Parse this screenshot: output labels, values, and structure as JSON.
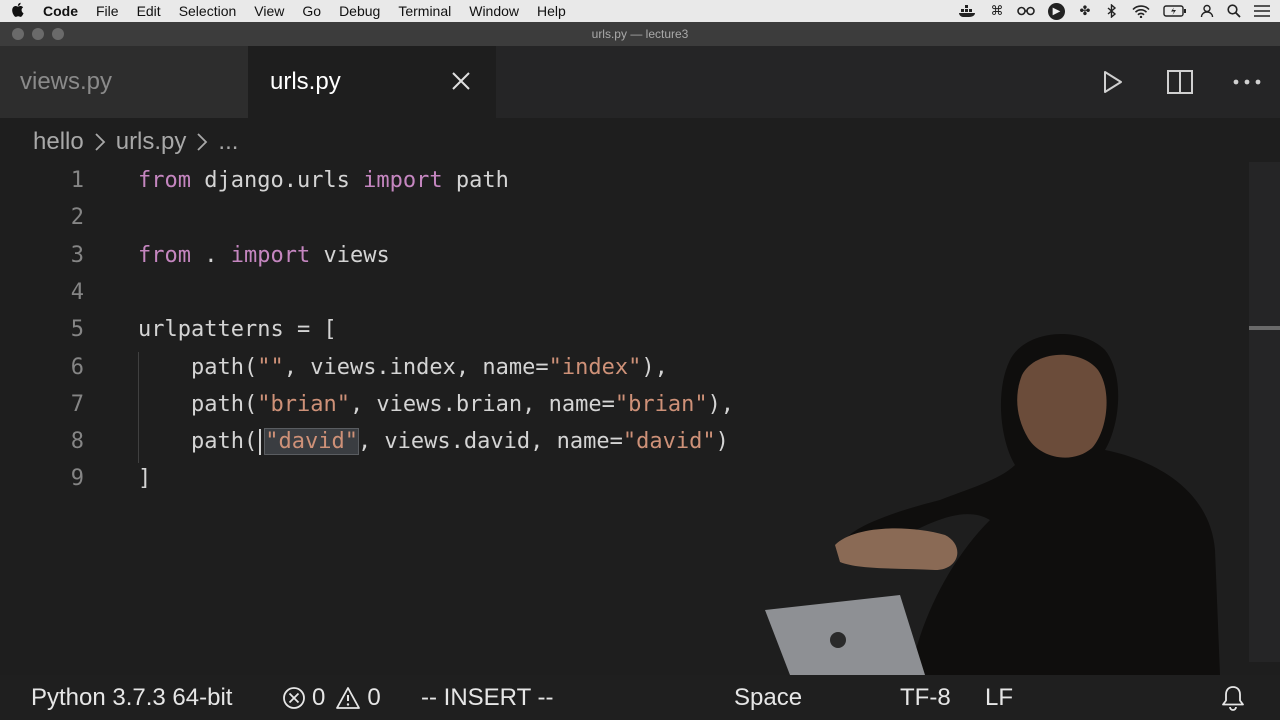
{
  "menubar": {
    "apple_icon": "apple-logo-icon",
    "items": [
      "Code",
      "File",
      "Edit",
      "Selection",
      "View",
      "Go",
      "Debug",
      "Terminal",
      "Window",
      "Help"
    ],
    "status_icons": [
      "docker-icon",
      "command-icon",
      "glasses-icon",
      "play-circle-icon",
      "flower-icon",
      "bluetooth-icon",
      "wifi-icon",
      "battery-icon",
      "user-icon",
      "search-icon",
      "menu-list-icon"
    ]
  },
  "window": {
    "title": "urls.py — lecture3"
  },
  "tabs": [
    {
      "label": "views.py",
      "active": false
    },
    {
      "label": "urls.py",
      "active": true
    }
  ],
  "breadcrumb": {
    "items": [
      "hello",
      "urls.py",
      "..."
    ]
  },
  "editor": {
    "lines": [
      {
        "n": "1",
        "tokens": [
          {
            "t": "from",
            "c": "kw"
          },
          {
            "t": " django.urls ",
            "c": ""
          },
          {
            "t": "import",
            "c": "kw"
          },
          {
            "t": " path",
            "c": ""
          }
        ]
      },
      {
        "n": "2",
        "tokens": []
      },
      {
        "n": "3",
        "tokens": [
          {
            "t": "from",
            "c": "kw"
          },
          {
            "t": " . ",
            "c": ""
          },
          {
            "t": "import",
            "c": "kw"
          },
          {
            "t": " views",
            "c": ""
          }
        ]
      },
      {
        "n": "4",
        "tokens": []
      },
      {
        "n": "5",
        "tokens": [
          {
            "t": "urlpatterns = [",
            "c": ""
          }
        ]
      },
      {
        "n": "6",
        "tokens": [
          {
            "t": "    path(",
            "c": ""
          },
          {
            "t": "\"\"",
            "c": "str"
          },
          {
            "t": ", views.index, name=",
            "c": ""
          },
          {
            "t": "\"index\"",
            "c": "str"
          },
          {
            "t": "),",
            "c": ""
          }
        ]
      },
      {
        "n": "7",
        "tokens": [
          {
            "t": "    path(",
            "c": ""
          },
          {
            "t": "\"brian\"",
            "c": "str"
          },
          {
            "t": ", views.brian, name=",
            "c": ""
          },
          {
            "t": "\"brian\"",
            "c": "str"
          },
          {
            "t": "),",
            "c": ""
          }
        ]
      },
      {
        "n": "8",
        "tokens": [
          {
            "t": "    path(",
            "c": ""
          },
          {
            "t": "CURSOR",
            "c": "cursor"
          },
          {
            "t": "\"david\"",
            "c": "str hl"
          },
          {
            "t": ", views.david, name=",
            "c": ""
          },
          {
            "t": "\"david\"",
            "c": "str"
          },
          {
            "t": ")",
            "c": ""
          }
        ]
      },
      {
        "n": "9",
        "tokens": [
          {
            "t": "]",
            "c": ""
          }
        ]
      }
    ]
  },
  "statusbar": {
    "python": "Python 3.7.3 64-bit",
    "errors": "0",
    "warnings": "0",
    "mode": "-- INSERT --",
    "spaces": "Space",
    "encoding": "TF-8",
    "eol": "LF"
  },
  "colors": {
    "keyword": "#c586c0",
    "string": "#ce9178",
    "text": "#d4d4d4",
    "background": "#1e1e1e"
  }
}
